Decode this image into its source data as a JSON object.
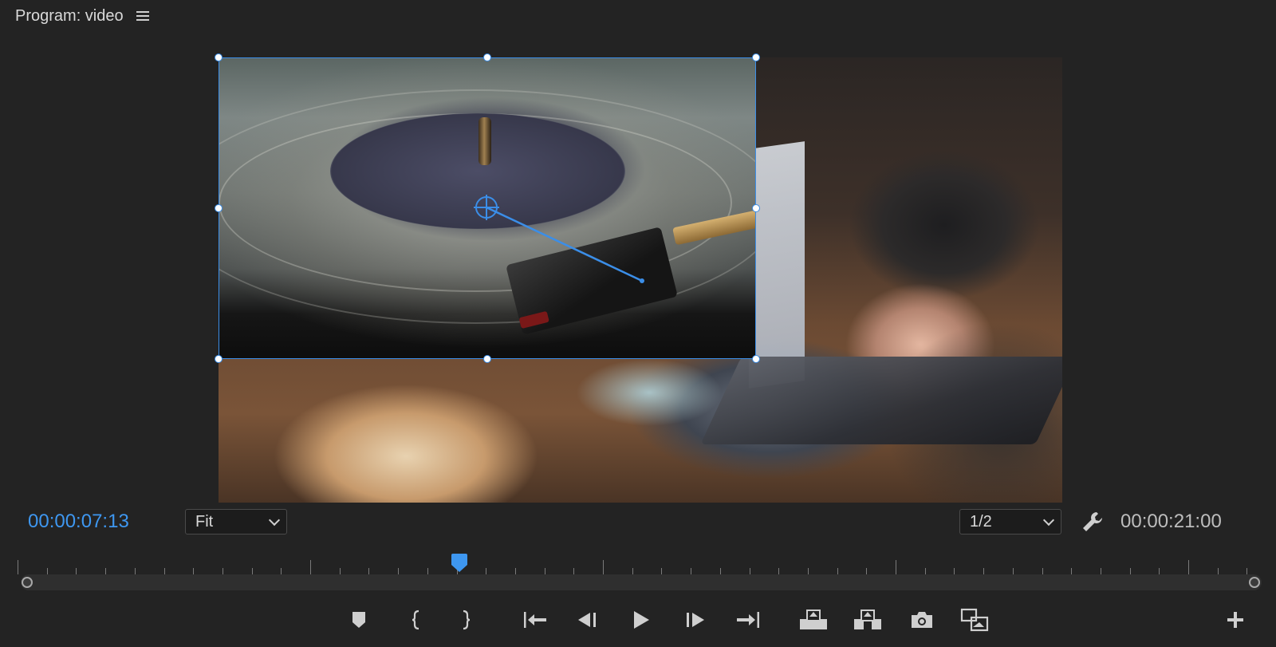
{
  "panel": {
    "title": "Program: video"
  },
  "playback": {
    "current_timecode": "00:00:07:13",
    "duration_timecode": "00:00:21:00",
    "zoom_selected": "Fit",
    "resolution_selected": "1/2",
    "playhead_position_fraction": 0.348
  },
  "transport": {
    "buttons": [
      "add-marker",
      "mark-in",
      "mark-out",
      "go-to-in",
      "step-back",
      "play",
      "step-forward",
      "go-to-out",
      "lift",
      "extract",
      "export-frame",
      "comparison-view",
      "button-editor"
    ]
  },
  "colors": {
    "accent": "#3e97f0",
    "background": "#232323",
    "selection": "#3b8ee8"
  }
}
